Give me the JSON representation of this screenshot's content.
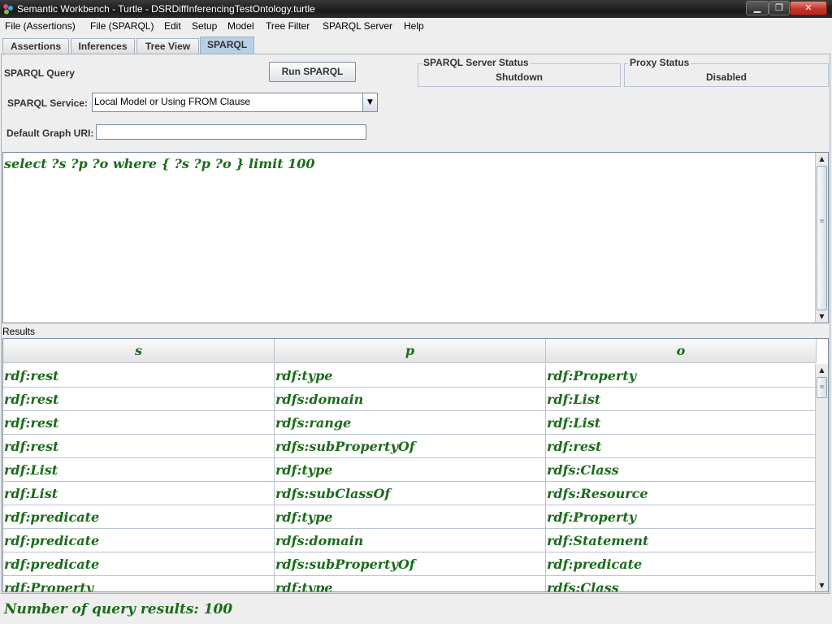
{
  "window": {
    "title": "Semantic Workbench - Turtle - DSRDiffInferencingTestOntology.turtle",
    "min_glyph": "▁",
    "max_glyph": "❐",
    "close_glyph": "✕"
  },
  "menu": [
    "File (Assertions)",
    "File (SPARQL)",
    "Edit",
    "Setup",
    "Model",
    "Tree Filter",
    "SPARQL Server",
    "Help"
  ],
  "tabs": [
    {
      "label": "Assertions",
      "selected": false
    },
    {
      "label": "Inferences",
      "selected": false
    },
    {
      "label": "Tree View",
      "selected": false
    },
    {
      "label": "SPARQL",
      "selected": true
    }
  ],
  "sparql": {
    "heading": "SPARQL Query",
    "run_button": "Run SPARQL",
    "server_status_title": "SPARQL Server Status",
    "server_status_value": "Shutdown",
    "proxy_status_title": "Proxy Status",
    "proxy_status_value": "Disabled",
    "service_label": "SPARQL Service:",
    "service_value": "Local Model or Using FROM Clause",
    "graph_label": "Default Graph URI:",
    "graph_value": "",
    "query": "select ?s ?p ?o where { ?s ?p ?o } limit 100"
  },
  "results": {
    "label": "Results",
    "columns": [
      "s",
      "p",
      "o"
    ],
    "rows": [
      [
        "rdf:rest",
        "rdf:type",
        "rdf:Property"
      ],
      [
        "rdf:rest",
        "rdfs:domain",
        "rdf:List"
      ],
      [
        "rdf:rest",
        "rdfs:range",
        "rdf:List"
      ],
      [
        "rdf:rest",
        "rdfs:subPropertyOf",
        "rdf:rest"
      ],
      [
        "rdf:List",
        "rdf:type",
        "rdfs:Class"
      ],
      [
        "rdf:List",
        "rdfs:subClassOf",
        "rdfs:Resource"
      ],
      [
        "rdf:predicate",
        "rdf:type",
        "rdf:Property"
      ],
      [
        "rdf:predicate",
        "rdfs:domain",
        "rdf:Statement"
      ],
      [
        "rdf:predicate",
        "rdfs:subPropertyOf",
        "rdf:predicate"
      ],
      [
        "rdf:Property",
        "rdf:type",
        "rdfs:Class"
      ]
    ]
  },
  "status_bar": "Number of query results: 100",
  "colors": {
    "result_text": "#1a6b1a",
    "selected_tab": "#b8cfe5"
  }
}
